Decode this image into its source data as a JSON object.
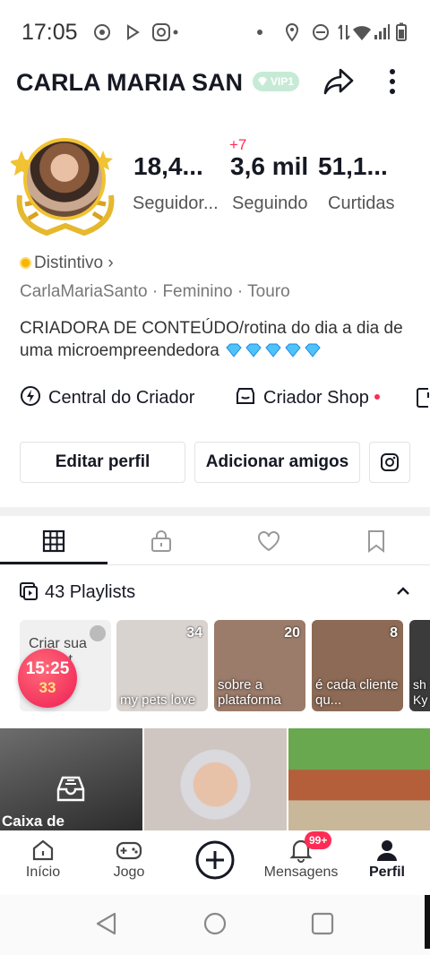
{
  "status_bar": {
    "time": "17:05"
  },
  "header": {
    "username": "CARLA MARIA SAN",
    "vip_label": "VIP1"
  },
  "stats": {
    "new_followers_badge": "+7",
    "followers_value": "18,4...",
    "followers_label": "Seguidor...",
    "following_value": "3,6 mil",
    "following_label": "Seguindo",
    "likes_value": "51,1...",
    "likes_label": "Curtidas"
  },
  "profile": {
    "badge_label": "Distintivo",
    "meta": "CarlaMariaSanto · Feminino · Touro",
    "bio": "CRIADORA DE CONTEÚDO/rotina do dia a dia de uma microempreendedora"
  },
  "creator_links": {
    "center": "Central do Criador",
    "shop": "Criador Shop"
  },
  "actions": {
    "edit": "Editar perfil",
    "add_friends": "Adicionar amigos"
  },
  "playlists": {
    "header": "43 Playlists",
    "create_label": "Criar sua playlist",
    "items": [
      {
        "title": "my pets love",
        "count": "34",
        "color": "#d9d3cf"
      },
      {
        "title": "sobre a plataforma",
        "count": "20",
        "color": "#9b7b6a"
      },
      {
        "title": "é cada cliente qu...",
        "count": "8",
        "color": "#8c6a55"
      },
      {
        "title": "sh Ky",
        "count": "",
        "color": "#3b3b3b"
      }
    ]
  },
  "timer": {
    "time": "15:25",
    "coins": "33"
  },
  "videos": {
    "drafts_label": "Caixa de"
  },
  "bottom_nav": {
    "home": "Início",
    "games": "Jogo",
    "messages": "Mensagens",
    "messages_badge": "99+",
    "profile": "Perfil"
  }
}
